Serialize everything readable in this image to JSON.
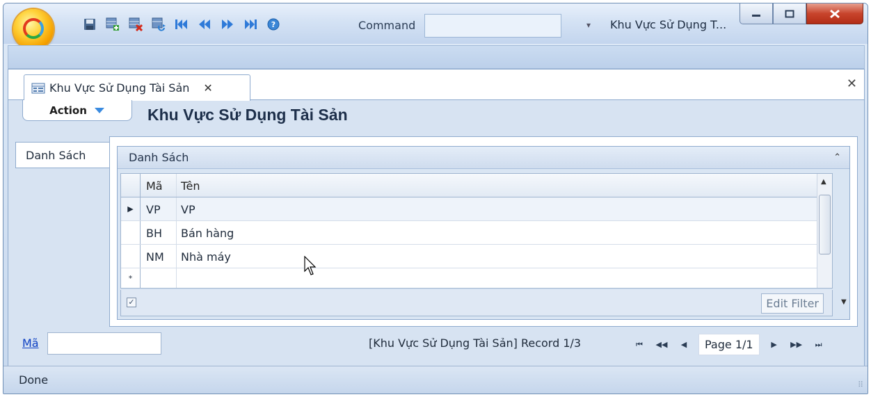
{
  "titlebar": {
    "command_label": "Command",
    "command_value": "",
    "title": "Khu Vực Sử Dụng T..."
  },
  "quick_access": [
    "save-icon",
    "add-row-icon",
    "delete-row-icon",
    "refresh-icon",
    "first-record-icon",
    "previous-record-icon",
    "next-record-icon",
    "last-record-icon",
    "help-icon"
  ],
  "document": {
    "tab_label": "Khu Vực Sử Dụng Tài Sản",
    "action_label": "Action",
    "page_title": "Khu Vực Sử Dụng Tài Sản",
    "side_tab_label": "Danh Sách",
    "group_title": "Danh Sách"
  },
  "grid": {
    "columns": [
      "Mã",
      "Tên"
    ],
    "rows": [
      {
        "ma": "VP",
        "ten": "VP"
      },
      {
        "ma": "BH",
        "ten": "Bán hàng"
      },
      {
        "ma": "NM",
        "ten": "Nhà máy"
      }
    ],
    "edit_filter_label": "Edit Filter"
  },
  "filter": {
    "ma_label": "Mã",
    "ma_value": "",
    "record_text": "[Khu Vực Sử Dụng Tài Sản] Record 1/3",
    "page_text": "Page 1/1"
  },
  "status": {
    "text": "Done"
  },
  "colors": {
    "accent": "#8eaace",
    "link": "#0b3ec2",
    "close": "#c8442c"
  }
}
